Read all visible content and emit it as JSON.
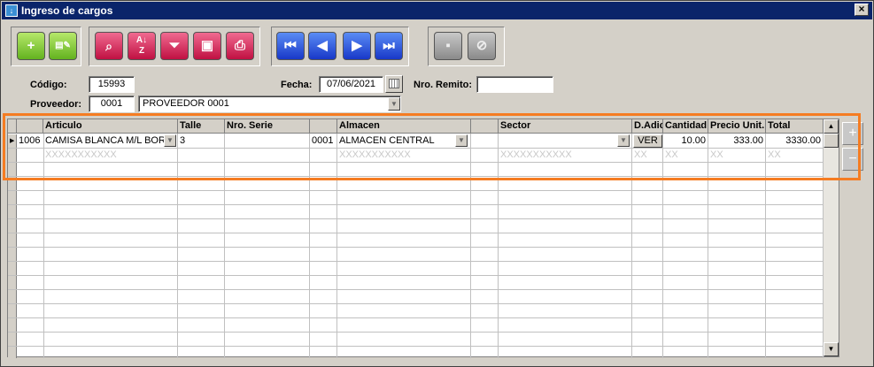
{
  "window": {
    "title": "Ingreso de cargos",
    "close_label": "×"
  },
  "form": {
    "codigo_label": "Código:",
    "codigo_value": "15993",
    "fecha_label": "Fecha:",
    "fecha_value": "07/06/2021",
    "remito_label": "Nro. Remito:",
    "remito_value": "",
    "proveedor_label": "Proveedor:",
    "proveedor_code": "0001",
    "proveedor_name": "PROVEEDOR 0001"
  },
  "grid": {
    "headers": {
      "articulo": "Articulo",
      "talle": "Talle",
      "serie": "Nro. Serie",
      "almacen": "Almacen",
      "sector": "Sector",
      "dadic": "D.Adic",
      "cantidad": "Cantidad",
      "precio": "Precio Unit.",
      "total": "Total"
    },
    "row1": {
      "codigo": "1006",
      "articulo": "CAMISA BLANCA M/L BORI",
      "talle": "3",
      "serie": "",
      "almacen_code": "0001",
      "almacen": "ALMACEN CENTRAL",
      "sector": "",
      "dadic": "VER",
      "cantidad": "10.00",
      "precio": "333.00",
      "total": "3330.00"
    },
    "placeholders": {
      "articulo": "XXXXXXXXXXX",
      "almacen": "XXXXXXXXXXX",
      "sector": "XXXXXXXXXXX",
      "dadic": "XX",
      "cantidad": "XX",
      "precio": "XX",
      "total": "XX"
    }
  },
  "icons": {
    "add": "+",
    "search": "🔍",
    "sort": "A Z",
    "filter": "▼",
    "first": "|◀",
    "prev": "◀",
    "next": "▶",
    "last": "▶|"
  }
}
